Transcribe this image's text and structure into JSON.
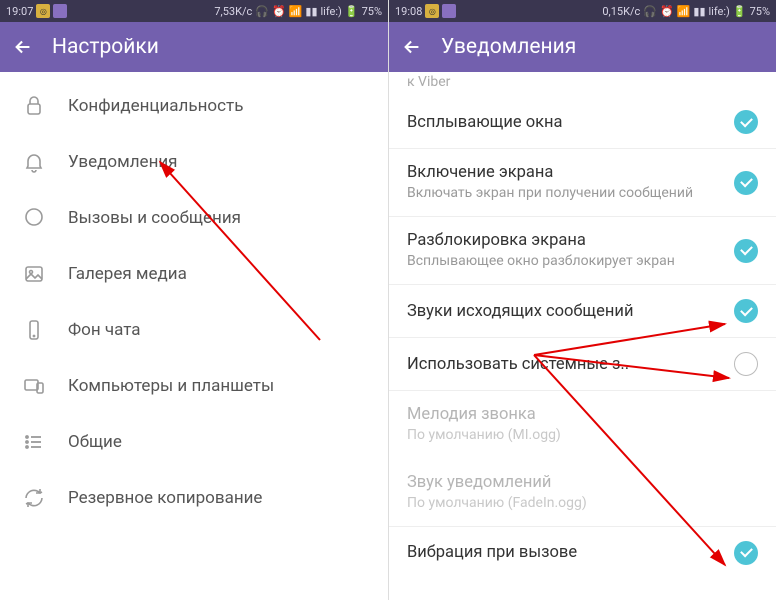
{
  "left": {
    "statusbar": {
      "time": "19:07",
      "speed": "7,53K/c",
      "carrier": "life:)",
      "battery": "75%"
    },
    "appbar": {
      "title": "Настройки"
    },
    "items": [
      {
        "label": "Конфиденциальность",
        "icon": "lock"
      },
      {
        "label": "Уведомления",
        "icon": "bell"
      },
      {
        "label": "Вызовы и сообщения",
        "icon": "chat"
      },
      {
        "label": "Галерея медиа",
        "icon": "image"
      },
      {
        "label": "Фон чата",
        "icon": "phone"
      },
      {
        "label": "Компьютеры и планшеты",
        "icon": "devices"
      },
      {
        "label": "Общие",
        "icon": "list"
      },
      {
        "label": "Резервное копирование",
        "icon": "sync"
      }
    ]
  },
  "right": {
    "statusbar": {
      "time": "19:08",
      "speed": "0,15K/c",
      "carrier": "life:)",
      "battery": "75%"
    },
    "appbar": {
      "title": "Уведомления"
    },
    "truncated_top": "к Viber",
    "items": [
      {
        "title": "Всплывающие окна",
        "sub": "",
        "checked": true
      },
      {
        "title": "Включение экрана",
        "sub": "Включать экран при получении сообщений",
        "checked": true
      },
      {
        "title": "Разблокировка экрана",
        "sub": "Всплывающее окно разблокирует экран",
        "checked": true
      },
      {
        "title": "Звуки исходящих сообщений",
        "sub": "",
        "checked": true
      },
      {
        "title": "Использовать системные з..",
        "sub": "",
        "checked": false
      },
      {
        "title": "Мелодия звонка",
        "sub": "По умолчанию (MI.ogg)",
        "disabled": true
      },
      {
        "title": "Звук уведомлений",
        "sub": "По умолчанию (FadeIn.ogg)",
        "disabled": true
      },
      {
        "title": "Вибрация при вызове",
        "sub": "",
        "checked": true
      }
    ]
  }
}
